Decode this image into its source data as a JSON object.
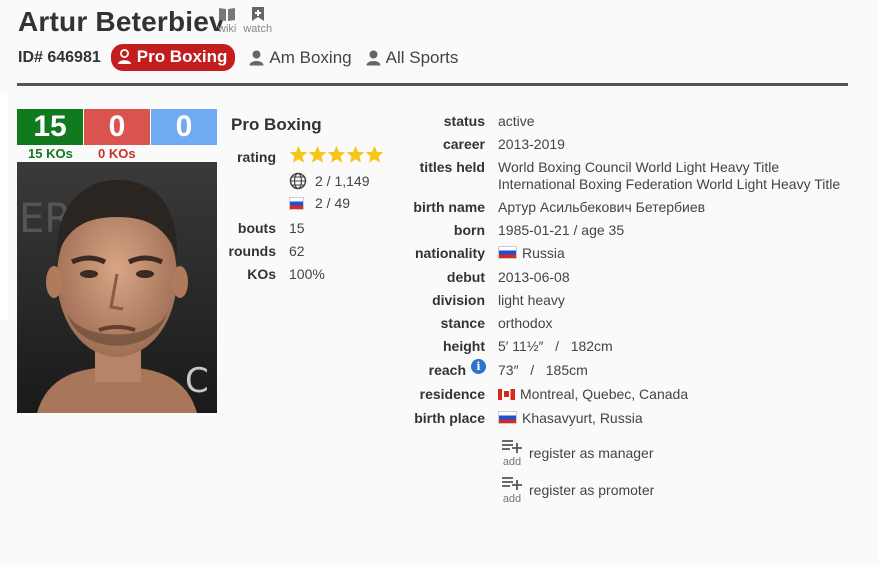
{
  "header": {
    "name": "Artur Beterbiev",
    "wiki_label": "wiki",
    "watch_label": "watch",
    "id_text": "ID# 646981"
  },
  "tabs": [
    {
      "label": "Pro Boxing",
      "active": true
    },
    {
      "label": "Am Boxing",
      "active": false
    },
    {
      "label": "All Sports",
      "active": false
    }
  ],
  "record": {
    "wins": "15",
    "losses": "0",
    "draws": "0",
    "win_kos": "15 KOs",
    "loss_kos": "0 KOs",
    "colors": {
      "win": "#117a1f",
      "loss": "#d9534f",
      "draw": "#6faaf2"
    }
  },
  "pro": {
    "title": "Pro Boxing",
    "rating_label": "rating",
    "stars": 5,
    "world_rank": "2 / 1,149",
    "country_rank": "2 / 49",
    "bouts_label": "bouts",
    "bouts": "15",
    "rounds_label": "rounds",
    "rounds": "62",
    "kos_label": "KOs",
    "kos": "100%"
  },
  "details": {
    "status_label": "status",
    "status": "active",
    "career_label": "career",
    "career": "2013-2019",
    "titles_label": "titles held",
    "title_1": "World Boxing Council World Light Heavy Title",
    "title_2": "International Boxing Federation World Light Heavy Title",
    "birthname_label": "birth name",
    "birthname": "Артур Асильбекович Бетербиев",
    "born_label": "born",
    "born": "1985-01-21 / age 35",
    "nationality_label": "nationality",
    "nationality": "Russia",
    "debut_label": "debut",
    "debut": "2013-06-08",
    "division_label": "division",
    "division": "light heavy",
    "stance_label": "stance",
    "stance": "orthodox",
    "height_label": "height",
    "height": "5′ 11½″   /   182cm",
    "reach_label": "reach",
    "reach": "73″   /   185cm",
    "residence_label": "residence",
    "residence": "Montreal, Quebec, Canada",
    "birthplace_label": "birth place",
    "birthplace": "Khasavyurt, Russia"
  },
  "actions": {
    "add_label": "add",
    "manager": "register as manager",
    "promoter": "register as promoter"
  },
  "icons": [
    "wiki-icon",
    "watch-icon",
    "person-icon",
    "globe-icon",
    "russia-flag-icon",
    "canada-flag-icon",
    "info-icon",
    "add-list-icon",
    "star-icon"
  ]
}
